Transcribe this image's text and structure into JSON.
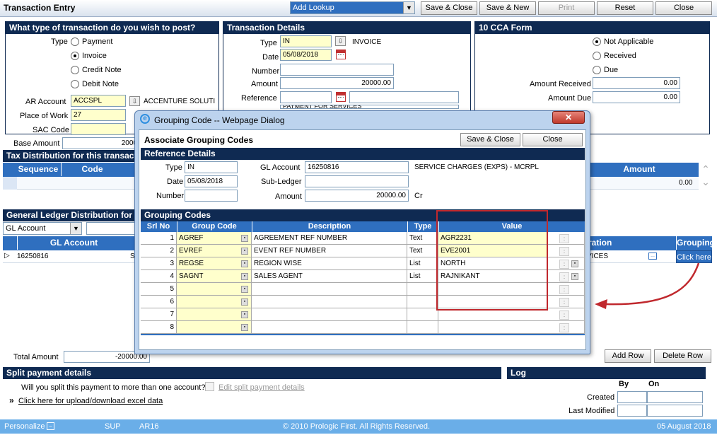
{
  "window": {
    "title": "Transaction Entry"
  },
  "toolbar": {
    "lookup_value": "Add Lookup",
    "save_close": "Save & Close",
    "save_new": "Save & New",
    "print": "Print",
    "reset": "Reset",
    "close": "Close"
  },
  "txn_type": {
    "heading": "What type of transaction do you wish to post?",
    "type_label": "Type",
    "options": [
      "Payment",
      "Invoice",
      "Credit Note",
      "Debit Note"
    ],
    "selected": "Invoice",
    "ar_account_label": "AR Account",
    "ar_account_value": "ACCSPL",
    "ar_account_desc": "ACCENTURE SOLUTI",
    "place_label": "Place of Work",
    "place_value": "27",
    "sac_label": "SAC Code",
    "base_amount_label": "Base Amount",
    "base_amount_value": "2000"
  },
  "txn_details": {
    "heading": "Transaction Details",
    "type_label": "Type",
    "type_value": "IN",
    "type_desc": "INVOICE",
    "date_label": "Date",
    "date_value": "05/08/2018",
    "number_label": "Number",
    "amount_label": "Amount",
    "amount_value": "20000.00",
    "reference_label": "Reference",
    "cut_text": "PAYMENT FOR SERVICES"
  },
  "cca": {
    "heading": "10 CCA Form",
    "options": [
      "Not Applicable",
      "Received",
      "Due"
    ],
    "selected": "Not Applicable",
    "amount_received_label": "Amount Received",
    "amount_received_value": "0.00",
    "amount_due_label": "Amount Due",
    "amount_due_value": "0.00"
  },
  "tax": {
    "heading": "Tax Distribution for this transaction",
    "cols": [
      "Sequence",
      "Code",
      "Amount"
    ],
    "amount_value": "0.00"
  },
  "gl": {
    "heading": "General Ledger Distribution for this transaction",
    "select_value": "GL Account",
    "cols": [
      "GL Account",
      "ration",
      "Grouping"
    ],
    "row_account": "16250816",
    "row_s": "S",
    "row_desc": "VICES",
    "grouping_link": "Click here"
  },
  "totals": {
    "label": "Total Amount",
    "value": "-20000.00",
    "add_row": "Add Row",
    "delete_row": "Delete Row"
  },
  "split": {
    "heading": "Split payment details",
    "question": "Will you split this payment to more than one account?",
    "edit_link": "Edit split payment details",
    "excel_link": "Click here for upload/download excel data"
  },
  "log": {
    "heading": "Log",
    "col_by": "By",
    "col_on": "On",
    "created": "Created",
    "modified": "Last Modified"
  },
  "footer": {
    "personalize": "Personalize",
    "sup": "SUP",
    "code": "AR16",
    "copyright": "© 2010 Prologic First. All Rights Reserved.",
    "date": "05 August 2018"
  },
  "dialog": {
    "title": "Grouping Code -- Webpage Dialog",
    "heading": "Associate Grouping Codes",
    "save_close": "Save & Close",
    "close": "Close",
    "ref_heading": "Reference Details",
    "type_label": "Type",
    "type_value": "IN",
    "date_label": "Date",
    "date_value": "05/08/2018",
    "number_label": "Number",
    "gl_label": "GL Account",
    "gl_value": "16250816",
    "gl_desc": "SERVICE CHARGES (EXPS) - MCRPL",
    "subledger_label": "Sub-Ledger",
    "amount_label": "Amount",
    "amount_value": "20000.00",
    "amount_crdr": "Cr",
    "grp_heading": "Grouping Codes",
    "cols": [
      "Srl No",
      "Group Code",
      "Description",
      "Type",
      "Value"
    ],
    "rows": [
      {
        "srl": "1",
        "code": "AGREF",
        "desc": "AGREEMENT REF NUMBER",
        "type": "Text",
        "value": "AGR2231"
      },
      {
        "srl": "2",
        "code": "EVREF",
        "desc": "EVENT REF NUMBER",
        "type": "Text",
        "value": "EVE2001"
      },
      {
        "srl": "3",
        "code": "REGSE",
        "desc": "REGION WISE",
        "type": "List",
        "value": "NORTH"
      },
      {
        "srl": "4",
        "code": "SAGNT",
        "desc": "SALES AGENT",
        "type": "List",
        "value": "RAJNIKANT"
      },
      {
        "srl": "5",
        "code": "",
        "desc": "",
        "type": "",
        "value": ""
      },
      {
        "srl": "6",
        "code": "",
        "desc": "",
        "type": "",
        "value": ""
      },
      {
        "srl": "7",
        "code": "",
        "desc": "",
        "type": "",
        "value": ""
      },
      {
        "srl": "8",
        "code": "",
        "desc": "",
        "type": "",
        "value": ""
      }
    ]
  },
  "colors": {
    "header_navy": "#0f2a52",
    "table_header_blue": "#2f6fbf",
    "highlight_red": "#c0282d",
    "field_yellow": "#ffffcc"
  }
}
